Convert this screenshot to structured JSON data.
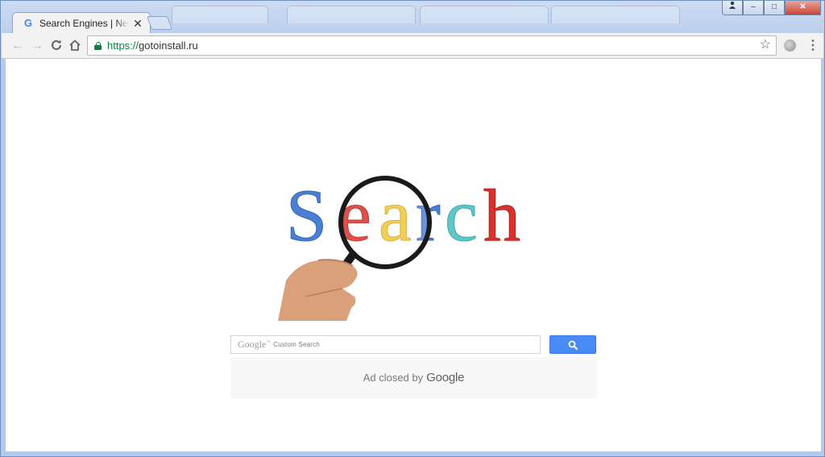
{
  "browser": {
    "tab": {
      "title": "Search Engines | News se",
      "favicon": "G",
      "close": "✕"
    },
    "toolbar": {
      "back": "←",
      "forward": "→",
      "reload": "⟳",
      "home": "⌂",
      "url_scheme": "https://",
      "url_host": "gotoinstall.ru",
      "star": "☆",
      "menu": "⋮"
    },
    "window_buttons": {
      "user": "👤",
      "minimize": "–",
      "maximize": "□",
      "close": "✕"
    }
  },
  "page": {
    "hero_word": "Search",
    "search": {
      "google_label": "Google",
      "google_tm": "™",
      "placeholder": "Custom Search"
    },
    "ad": {
      "text": "Ad closed by",
      "brand": "Google"
    }
  },
  "colors": {
    "google_blue": "#4285f4",
    "google_red": "#db3236",
    "google_yellow": "#f4c20d",
    "google_teal": "#5ec2c8",
    "secure_green": "#0b8043",
    "search_button": "#4a8af4"
  }
}
